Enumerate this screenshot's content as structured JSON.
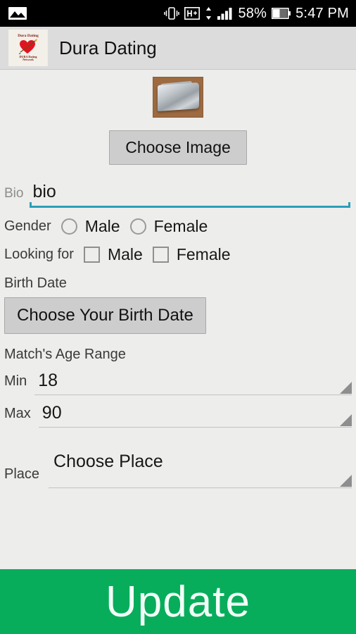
{
  "status_bar": {
    "notification_icon": "photo-notification-icon",
    "vibrate_icon": "vibrate-icon",
    "network_icon": "hsdpa-hplus-icon",
    "network_label": "H+",
    "data_arrows_icon": "data-transfer-arrows-icon",
    "signal_icon": "signal-bars-icon",
    "battery_percent": "58%",
    "battery_icon": "battery-icon",
    "time": "5:47 PM"
  },
  "app_bar": {
    "logo_top_text": "Dura Dating",
    "logo_bottom_line1": "DURA Dating",
    "logo_bottom_line2": "Network",
    "logo_icon": "heart-with-arrow-logo",
    "title": "Dura Dating"
  },
  "form": {
    "profile_image_alt": "profile-photo-silver-wallet-on-brown-background",
    "choose_image_label": "Choose Image",
    "bio": {
      "label": "Bio",
      "value": "bio",
      "placeholder": "bio",
      "underline_color": "#2a9fb8"
    },
    "gender": {
      "label": "Gender",
      "options": [
        {
          "label": "Male",
          "selected": false
        },
        {
          "label": "Female",
          "selected": false
        }
      ]
    },
    "looking_for": {
      "label": "Looking for",
      "options": [
        {
          "label": "Male",
          "checked": false
        },
        {
          "label": "Female",
          "checked": false
        }
      ]
    },
    "birth_date": {
      "label": "Birth Date",
      "button_label": "Choose Your Birth Date"
    },
    "age_range": {
      "label": "Match's Age Range",
      "min": {
        "label": "Min",
        "value": "18"
      },
      "max": {
        "label": "Max",
        "value": "90"
      }
    },
    "place": {
      "label": "Place",
      "value": "Choose Place"
    }
  },
  "footer": {
    "update_label": "Update",
    "update_color": "#08ad5b"
  }
}
